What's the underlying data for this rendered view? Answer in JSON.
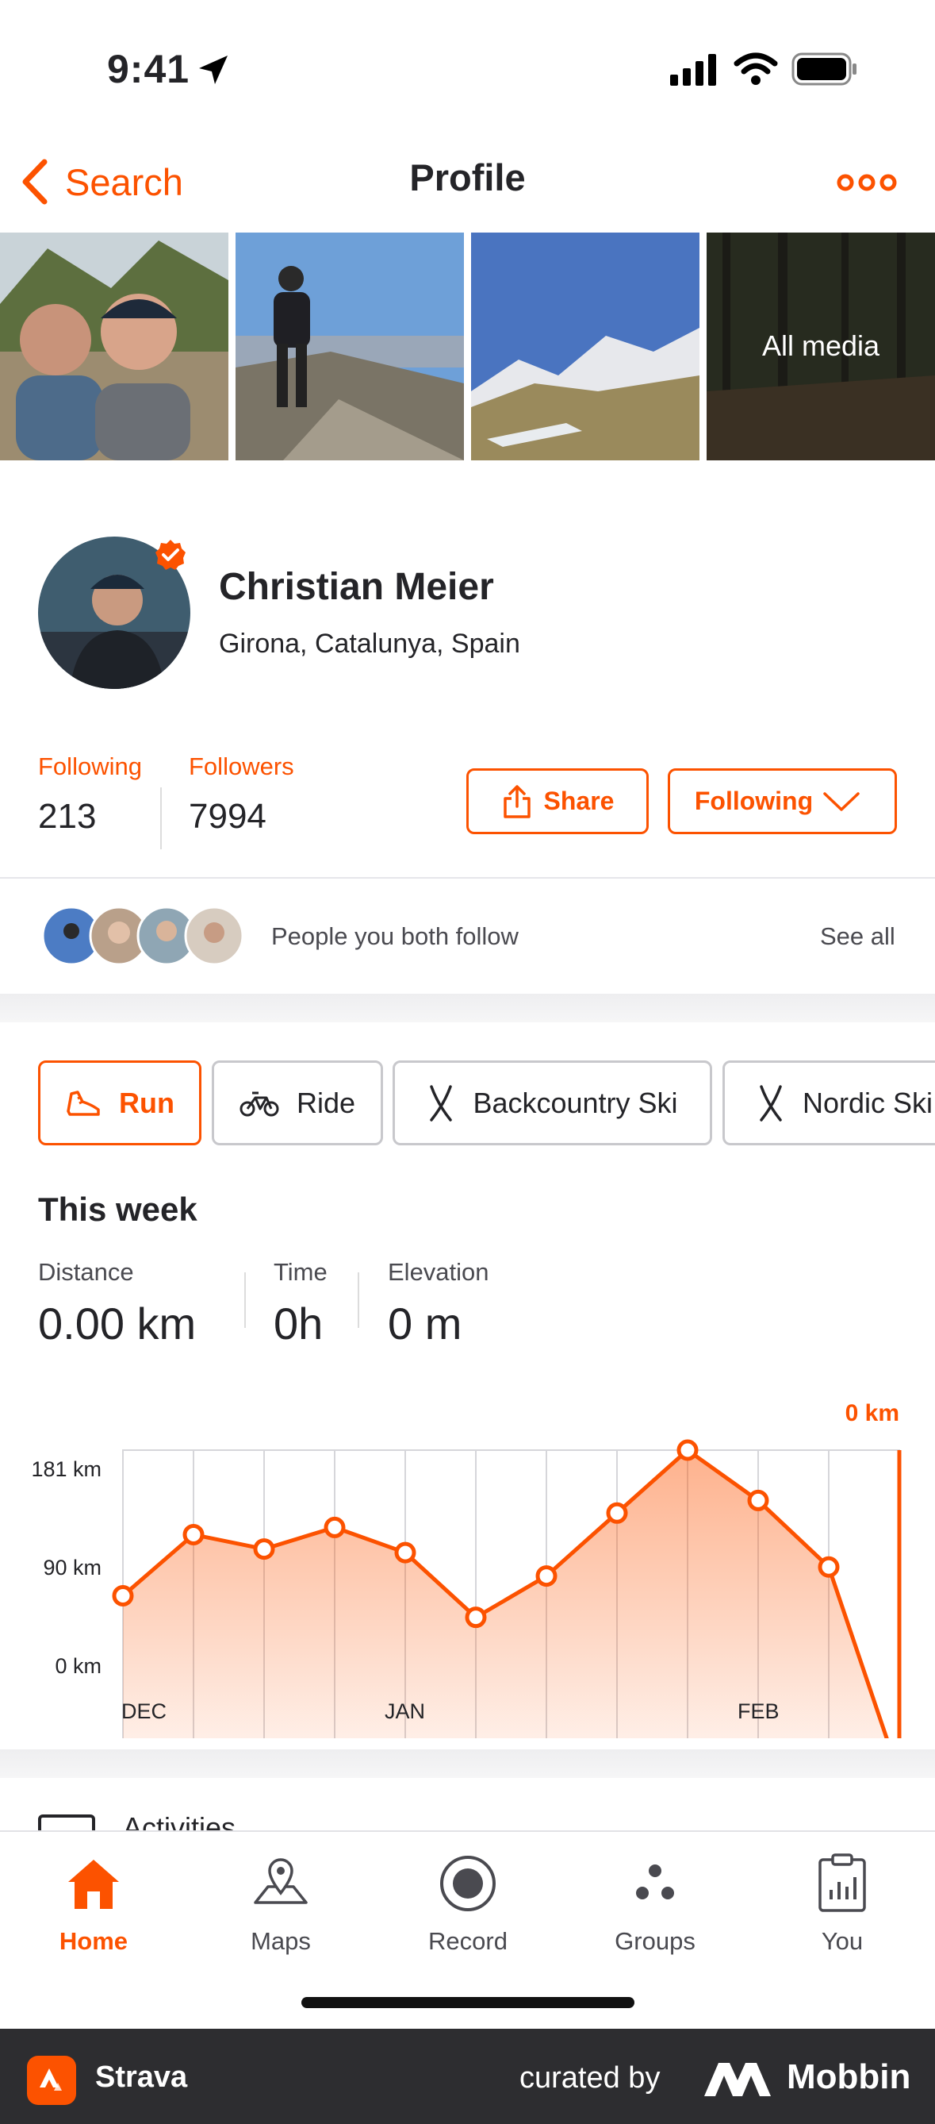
{
  "status_bar": {
    "time": "9:41"
  },
  "nav": {
    "back_label": "Search",
    "title": "Profile"
  },
  "media": {
    "all_media_label": "All media"
  },
  "profile": {
    "name": "Christian Meier",
    "location": "Girona, Catalunya, Spain",
    "following_label": "Following",
    "following_count": "213",
    "followers_label": "Followers",
    "followers_count": "7994",
    "share_label": "Share",
    "follow_state_label": "Following"
  },
  "mutual": {
    "text": "People you both follow",
    "see_all": "See all"
  },
  "sports": {
    "chips": [
      {
        "label": "Run",
        "selected": true
      },
      {
        "label": "Ride",
        "selected": false
      },
      {
        "label": "Backcountry Ski",
        "selected": false
      },
      {
        "label": "Nordic Ski",
        "selected": false
      }
    ]
  },
  "this_week": {
    "title": "This week",
    "distance_label": "Distance",
    "distance_value": "0.00 km",
    "time_label": "Time",
    "time_value": "0h",
    "elevation_label": "Elevation",
    "elevation_value": "0 m"
  },
  "chart_data": {
    "type": "area",
    "title": "",
    "y_tick_labels": [
      "181 km",
      "90 km",
      "0 km"
    ],
    "x_tick_labels": [
      "DEC",
      "JAN",
      "FEB"
    ],
    "current_label": "0 km",
    "ylim": [
      0,
      181
    ],
    "values": [
      100,
      134,
      126,
      138,
      124,
      88,
      111,
      146,
      181,
      153,
      116,
      0
    ],
    "accent": "#fc5200"
  },
  "activities": {
    "label": "Activities"
  },
  "tabs": [
    {
      "label": "Home",
      "active": true
    },
    {
      "label": "Maps",
      "active": false
    },
    {
      "label": "Record",
      "active": false
    },
    {
      "label": "Groups",
      "active": false
    },
    {
      "label": "You",
      "active": false
    }
  ],
  "footer": {
    "app_name": "Strava",
    "curated_by": "curated by",
    "brand": "Mobbin"
  },
  "colors": {
    "accent": "#fc5200",
    "text": "#242428",
    "muted": "#4a4a50"
  }
}
